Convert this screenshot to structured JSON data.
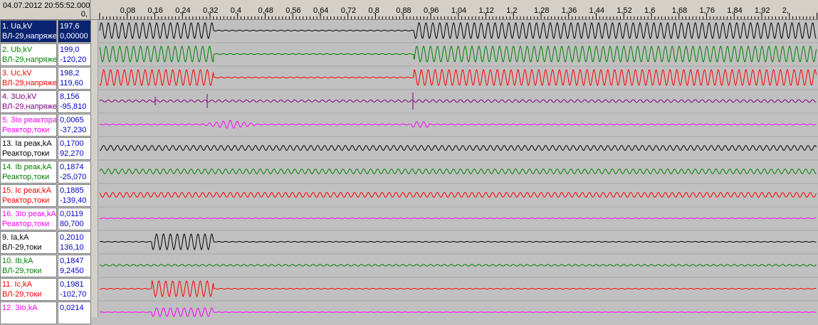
{
  "header": {
    "timestamp": "04.07.2012 20:55:52.000",
    "origin": "0,"
  },
  "axis": {
    "ticks": [
      "0,08",
      "0,16",
      "0,24",
      "0,32",
      "0,4",
      "0,48",
      "0,56",
      "0,64",
      "0,72",
      "0,8",
      "0,88",
      "0,96",
      "1,04",
      "1,12",
      "1,2",
      "1,28",
      "1,36",
      "1,44",
      "1,52",
      "1,6",
      "1,68",
      "1,76",
      "1,84",
      "1,92",
      "2,"
    ]
  },
  "channels": [
    {
      "name": "1. Ua,kV",
      "group": "ВЛ-29,напряже",
      "v1": "197,6",
      "v2": "0,00000",
      "color": "#000000",
      "selected": true,
      "pattern": "ua"
    },
    {
      "name": "2. Ub,kV",
      "group": "ВЛ-29,напряже",
      "v1": "199,0",
      "v2": "-120,20",
      "color": "#008000",
      "selected": false,
      "pattern": "ub"
    },
    {
      "name": "3. Uc,kV",
      "group": "ВЛ-29,напряже",
      "v1": "198,2",
      "v2": "119,60",
      "color": "#ff0000",
      "selected": false,
      "pattern": "ub"
    },
    {
      "name": "4. 3Uo,kV",
      "group": "ВЛ-29,напряже",
      "v1": "8,156",
      "v2": "-95,810",
      "color": "#800080",
      "selected": false,
      "pattern": "u0"
    },
    {
      "name": "5. 3Io реактора",
      "group": "Реактор,токи",
      "v1": "0,0065",
      "v2": "-37,230",
      "color": "#ff00ff",
      "selected": false,
      "pattern": "i0r"
    },
    {
      "name": "13. Ia реак,kA",
      "group": "Реактор,токи",
      "v1": "0,1700",
      "v2": "92,270",
      "color": "#000000",
      "selected": false,
      "pattern": "small"
    },
    {
      "name": "14. Ib реак,kA",
      "group": "Реактор,токи",
      "v1": "0,1874",
      "v2": "-25,070",
      "color": "#008000",
      "selected": false,
      "pattern": "small"
    },
    {
      "name": "15. Ic реак,kA",
      "group": "Реактор,токи",
      "v1": "0,1885",
      "v2": "-139,40",
      "color": "#ff0000",
      "selected": false,
      "pattern": "small"
    },
    {
      "name": "16. 3Io реак,kA",
      "group": "Реактор,токи",
      "v1": "0,0119",
      "v2": "80,700",
      "color": "#ff00ff",
      "selected": false,
      "pattern": "flat"
    },
    {
      "name": "9. Ia,kA",
      "group": "ВЛ-29,токи",
      "v1": "0,2010",
      "v2": "136,10",
      "color": "#000000",
      "selected": false,
      "pattern": "fault"
    },
    {
      "name": "10. Ib,kA",
      "group": "ВЛ-29,токи",
      "v1": "0,1847",
      "v2": "9,2450",
      "color": "#008000",
      "selected": false,
      "pattern": "tiny"
    },
    {
      "name": "11. Ic,kA",
      "group": "ВЛ-29,токи",
      "v1": "0,1981",
      "v2": "-102,70",
      "color": "#ff0000",
      "selected": false,
      "pattern": "fault"
    },
    {
      "name": "12. 3Io,kA",
      "group": "",
      "v1": "0,0214",
      "v2": "",
      "color": "#ff00ff",
      "selected": false,
      "pattern": "fault2"
    }
  ]
}
